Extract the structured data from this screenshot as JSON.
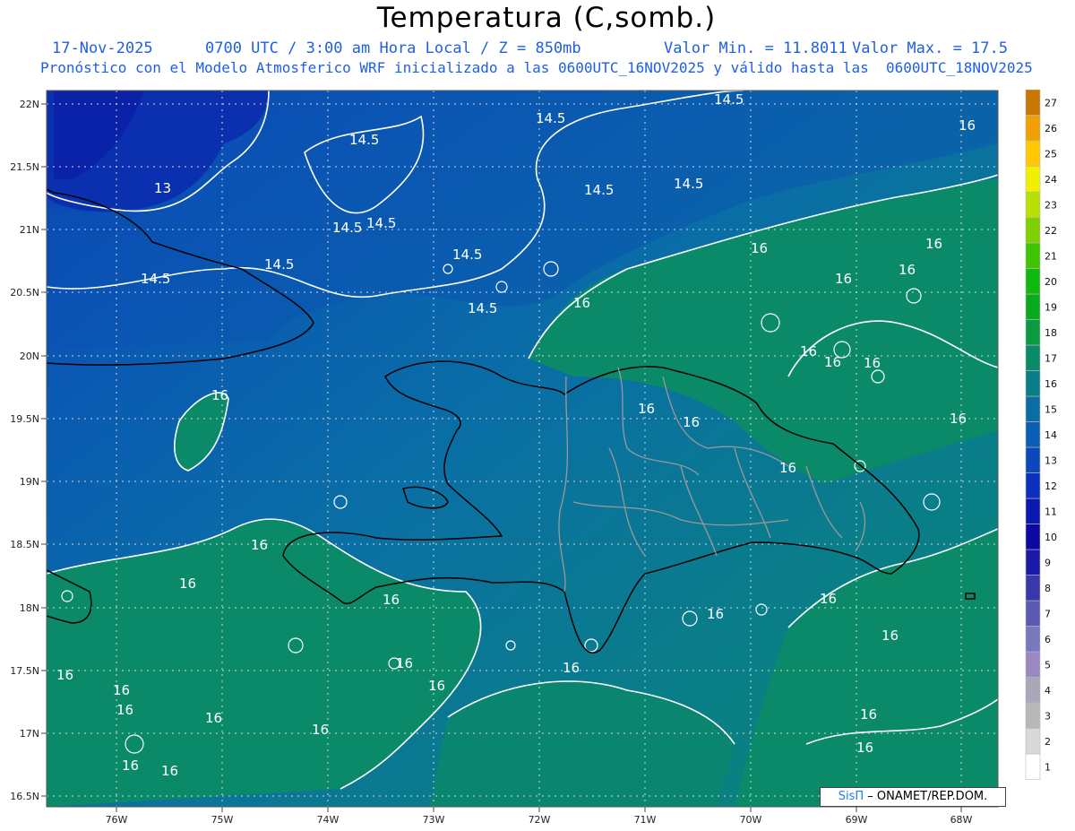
{
  "title": "Temperatura (C,somb.)",
  "header": {
    "date": "17-Nov-2025",
    "time": "0700 UTC / 3:00 am Hora Local / Z = 850mb",
    "min": "Valor Min. = 11.8011",
    "max": "Valor Max. = 17.5",
    "model": "Pronóstico con el Modelo Atmosferico WRF inicializado a las 0600UTC_16NOV2025 y válido hasta las  0600UTC_18NOV2025"
  },
  "axes": {
    "lat_labels": [
      "22N",
      "21.5N",
      "21N",
      "20.5N",
      "20N",
      "19.5N",
      "19N",
      "18.5N",
      "18N",
      "17.5N",
      "17N",
      "16.5N"
    ],
    "lon_labels": [
      "76W",
      "75W",
      "74W",
      "73W",
      "72W",
      "71W",
      "70W",
      "69W",
      "68W"
    ]
  },
  "legend": {
    "levels": [
      "1",
      "2",
      "3",
      "4",
      "5",
      "6",
      "7",
      "8",
      "9",
      "10",
      "11",
      "12",
      "13",
      "14",
      "15",
      "16",
      "17",
      "18",
      "19",
      "20",
      "21",
      "22",
      "23",
      "24",
      "25",
      "26",
      "27"
    ],
    "colors": [
      "#ffffff",
      "#d9d9d9",
      "#b8b8b8",
      "#a8a8b8",
      "#9a88c0",
      "#7878bc",
      "#5a5ab4",
      "#3838aa",
      "#1a1aa8",
      "#0a0aa0",
      "#0a1ab0",
      "#0a30bc",
      "#0a48bc",
      "#0a5eb4",
      "#0a6ea4",
      "#0a7e86",
      "#0a8a68",
      "#0a9a40",
      "#0aaa20",
      "#10b810",
      "#40c400",
      "#80d000",
      "#b8e000",
      "#f0f000",
      "#ffc800",
      "#f0a000",
      "#c87800"
    ]
  },
  "contour_labels": [
    "14.5",
    "16",
    "13"
  ],
  "credit": {
    "sis": "SisΠ",
    "rest": " – ONAMET/REP.DOM."
  }
}
